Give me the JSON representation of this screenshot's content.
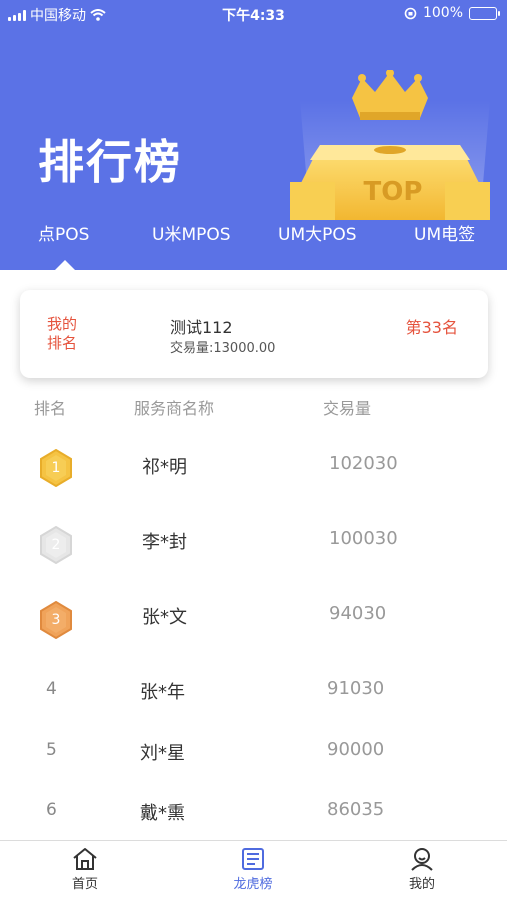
{
  "status_bar": {
    "carrier": "中国移动",
    "time": "下午4:33",
    "battery": "100%",
    "battery_level": 1.0
  },
  "header": {
    "title": "排行榜",
    "trophy_text": "TOP",
    "tabs": [
      "点POS",
      "U米MPOS",
      "UM大POS",
      "UM电签"
    ],
    "active_tab": 0
  },
  "my_rank": {
    "label": "我的排名",
    "name": "测试112",
    "volume": "交易量:13000.00",
    "rank": "第33名"
  },
  "list": {
    "columns": [
      "排名",
      "服务商名称",
      "交易量"
    ],
    "rows": [
      {
        "rank": "1",
        "name": "祁*明",
        "volume": "102030"
      },
      {
        "rank": "2",
        "name": "李*封",
        "volume": "100030"
      },
      {
        "rank": "3",
        "name": "张*文",
        "volume": "94030"
      },
      {
        "rank": "4",
        "name": "张*年",
        "volume": "91030"
      },
      {
        "rank": "5",
        "name": "刘*星",
        "volume": "90000"
      },
      {
        "rank": "6",
        "name": "戴*熏",
        "volume": "86035"
      }
    ]
  },
  "bottom_nav": {
    "items": [
      {
        "label": "首页",
        "icon": "home-icon"
      },
      {
        "label": "龙虎榜",
        "icon": "leaderboard-icon"
      },
      {
        "label": "我的",
        "icon": "user-icon"
      }
    ],
    "active": 1
  },
  "colors": {
    "header_bg": "#5b72e6",
    "accent_red": "#e5533d",
    "active_blue": "#4f6bdf",
    "gold": "#f5c343",
    "silver": "#e6e6e6",
    "bronze": "#f0a35a"
  }
}
